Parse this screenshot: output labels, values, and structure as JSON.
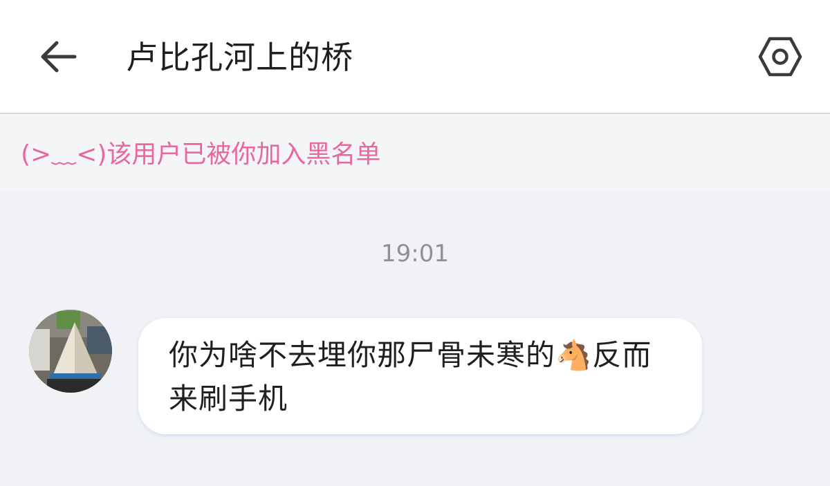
{
  "header": {
    "back_icon": "arrow-left-icon",
    "title": "卢比孔河上的桥",
    "settings_icon": "hexagon-gear-icon"
  },
  "notice": {
    "text": "(>﹏<)该用户已被你加入黑名单",
    "color": "#e8689a"
  },
  "chat": {
    "messages": [
      {
        "time": "19:01",
        "sender_avatar_icon": "pyramid-photo-avatar",
        "text": "你为啥不去埋你那尸骨未寒的🐴反而来刷手机"
      }
    ]
  }
}
